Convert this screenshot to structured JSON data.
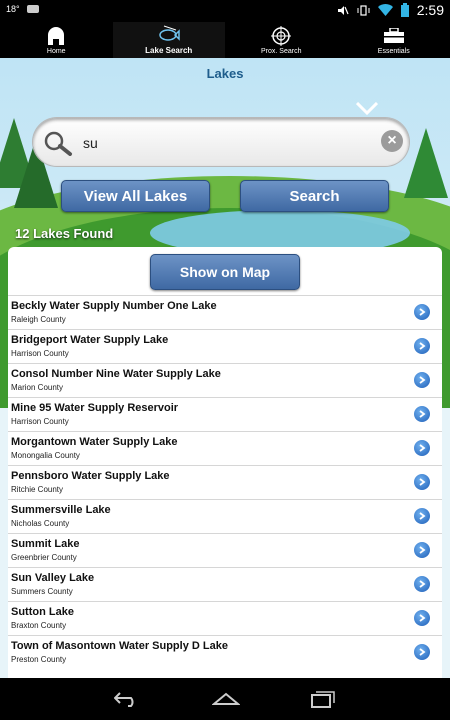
{
  "status_bar": {
    "temp": "18°",
    "time": "2:59"
  },
  "tabs": [
    {
      "label": "Home",
      "icon": "home-icon"
    },
    {
      "label": "Lake Search",
      "icon": "fish-icon"
    },
    {
      "label": "Prox. Search",
      "icon": "crosshair-icon"
    },
    {
      "label": "Essentials",
      "icon": "toolbox-icon"
    }
  ],
  "page_title": "Lakes",
  "search": {
    "value": "su"
  },
  "buttons": {
    "view_all": "View All Lakes",
    "search": "Search",
    "show_on_map": "Show on Map"
  },
  "result_count": "12 Lakes  Found",
  "lakes": [
    {
      "name": "Beckly Water Supply Number One Lake",
      "county": "Raleigh County"
    },
    {
      "name": "Bridgeport Water Supply Lake",
      "county": "Harrison County"
    },
    {
      "name": "Consol Number Nine Water Supply Lake",
      "county": "Marion County"
    },
    {
      "name": "Mine 95 Water Supply Reservoir",
      "county": "Harrison County"
    },
    {
      "name": "Morgantown Water Supply Lake",
      "county": "Monongalia County"
    },
    {
      "name": "Pennsboro Water Supply Lake",
      "county": "Ritchie County"
    },
    {
      "name": "Summersville Lake",
      "county": "Nicholas County"
    },
    {
      "name": "Summit Lake",
      "county": "Greenbrier County"
    },
    {
      "name": "Sun Valley Lake",
      "county": "Summers County"
    },
    {
      "name": "Sutton Lake",
      "county": "Braxton County"
    },
    {
      "name": "Town of Masontown Water Supply D Lake",
      "county": "Preston County"
    }
  ],
  "colors": {
    "accent_blue": "#4a74ad",
    "title_blue": "#1e5d8c",
    "grass": "#3f9a2e"
  }
}
